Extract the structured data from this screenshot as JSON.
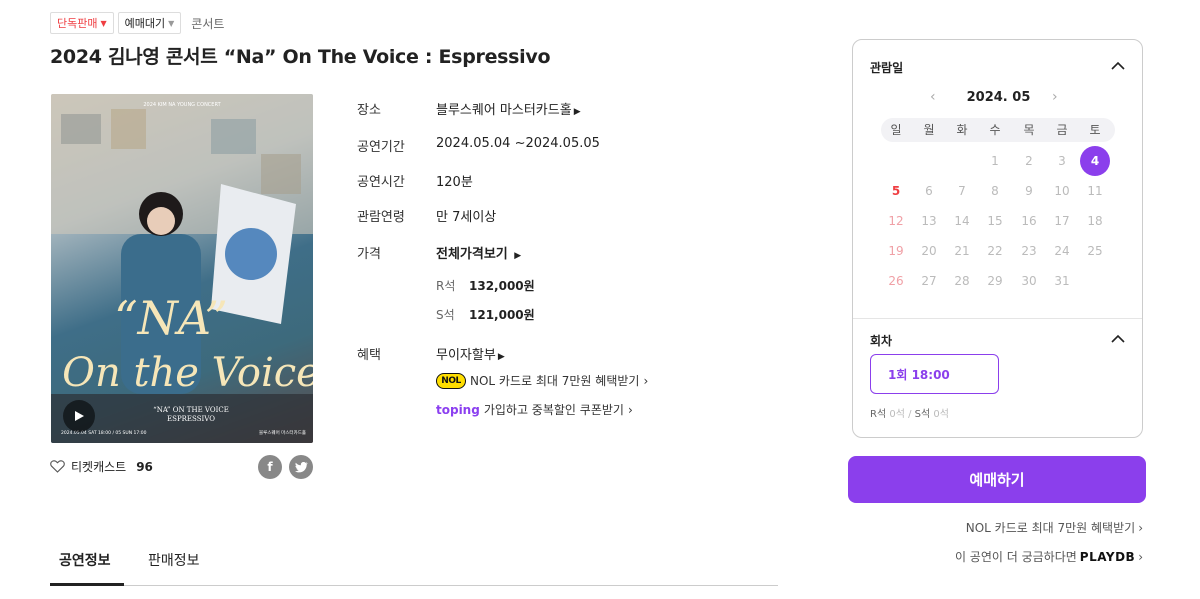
{
  "tags": {
    "exclusive": "단독판매",
    "waiting": "예매대기",
    "genre": "콘서트"
  },
  "title": "2024 김나영 콘서트 “Na” On The Voice : Espressivo",
  "poster": {
    "header_text": "2024 KIM NA YOUNG CONCERT",
    "title_line1": "“NA”",
    "title_line2": "On the Voice",
    "subtitle": "“NA” ON THE VOICE",
    "subtitle2": "ESPRESSIVO",
    "dates": "2024.05.04 SAT 18:00 / 05 SUN 17:00",
    "venue_small": "블루스퀘어 마스터카드홀"
  },
  "favorite": {
    "label": "티켓캐스트",
    "count": "96"
  },
  "info": {
    "venue_label": "장소",
    "venue": "블루스퀘어 마스터카드홀",
    "period_label": "공연기간",
    "period": "2024.05.04 ~2024.05.05",
    "runtime_label": "공연시간",
    "runtime": "120분",
    "age_label": "관람연령",
    "age": "만 7세이상",
    "price_label": "가격",
    "price_link": "전체가격보기",
    "prices": [
      {
        "grade": "R석",
        "price": "132,000원"
      },
      {
        "grade": "S석",
        "price": "121,000원"
      }
    ],
    "benefit_label": "혜택",
    "benefit_main": "무이자할부",
    "nol_logo": "NOL",
    "nol_text": "NOL 카드로 최대 7만원 혜택받기",
    "toping_logo": "toping",
    "toping_text": "가입하고 중복할인 쿠폰받기"
  },
  "tabs": [
    "공연정보",
    "판매정보"
  ],
  "calendar": {
    "header": "관람일",
    "month": "2024. 05",
    "weekdays": [
      "일",
      "월",
      "화",
      "수",
      "목",
      "금",
      "토"
    ],
    "days": [
      "1",
      "2",
      "3",
      "4",
      "5",
      "6",
      "7",
      "8",
      "9",
      "10",
      "11",
      "12",
      "13",
      "14",
      "15",
      "16",
      "17",
      "18",
      "19",
      "20",
      "21",
      "22",
      "23",
      "24",
      "25",
      "26",
      "27",
      "28",
      "29",
      "30",
      "31"
    ],
    "selected_day": "4"
  },
  "session": {
    "header": "회차",
    "option": "1회 18:00",
    "r_label": "R석",
    "r_count": "0석",
    "s_label": "S석",
    "s_count": "0석"
  },
  "book_button": "예매하기",
  "side_links": {
    "nol": "NOL 카드로 최대 7만원 혜택받기",
    "playdb_text": "이 공연이 더 궁금하다면",
    "playdb_logo": "PLAYDB"
  },
  "colors": {
    "accent": "#8b3fec",
    "red": "#ef3e42"
  }
}
